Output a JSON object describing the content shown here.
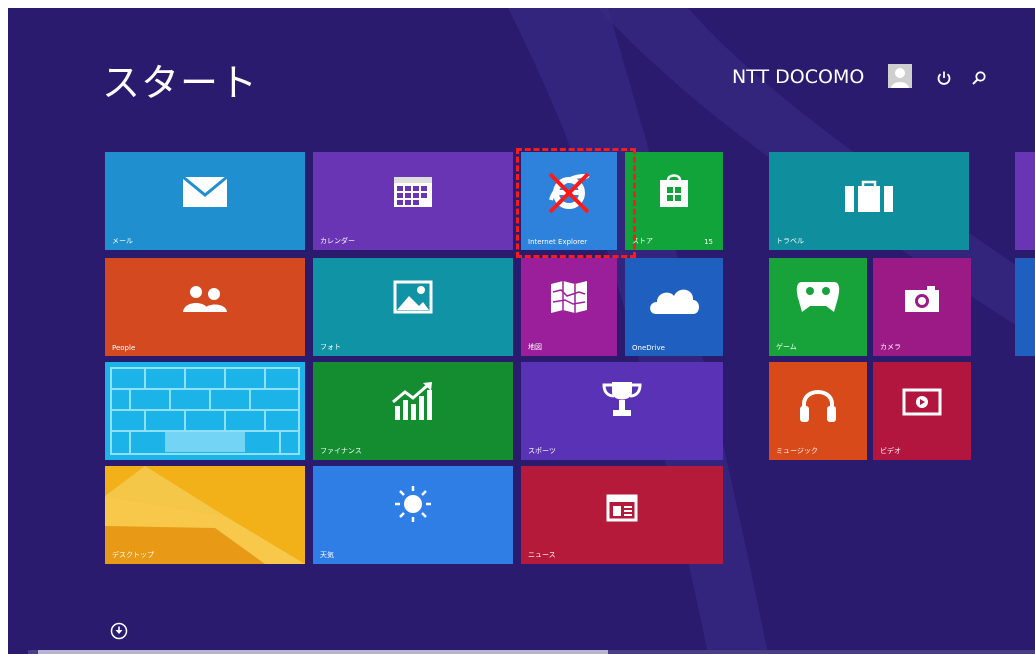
{
  "start_title": "スタート",
  "user_name": "NTT DOCOMO",
  "icons": {
    "user": "user-avatar-icon",
    "power": "power-icon",
    "search": "search-icon",
    "down": "down-arrow-circle-icon"
  },
  "tiles": {
    "mail": {
      "label": "メール",
      "color": "#1f8fcf"
    },
    "calendar": {
      "label": "カレンダー",
      "color": "#6a35b5"
    },
    "ie": {
      "label": "Internet Explorer",
      "color": "#2f82dc"
    },
    "store": {
      "label": "ストア",
      "badge": "15",
      "color": "#10a43a"
    },
    "travel": {
      "label": "トラベル",
      "color": "#0f8f9e"
    },
    "people": {
      "label": "People",
      "color": "#d4491f"
    },
    "photos": {
      "label": "フォト",
      "color": "#0f93a5"
    },
    "maps": {
      "label": "地図",
      "color": "#9b1f9b"
    },
    "onedrive": {
      "label": "OneDrive",
      "color": "#1e5fbf"
    },
    "games": {
      "label": "ゲーム",
      "color": "#17a33a"
    },
    "camera": {
      "label": "カメラ",
      "color": "#9b1a86"
    },
    "desktop_keyboard": {
      "label": "",
      "color": "#1cb3e8"
    },
    "finance": {
      "label": "ファイナンス",
      "color": "#138d2f"
    },
    "sports": {
      "label": "スポーツ",
      "color": "#5a32b5"
    },
    "music": {
      "label": "ミュージック",
      "color": "#d84a1a"
    },
    "video": {
      "label": "ビデオ",
      "color": "#b2163f"
    },
    "desktop": {
      "label": "デスクトップ",
      "color": "#f2b118"
    },
    "weather": {
      "label": "天気",
      "color": "#2f7ee6"
    },
    "news": {
      "label": "ニュース",
      "color": "#b51a3a"
    }
  },
  "annotation": {
    "ie_disabled": true,
    "marker_color": "#ff1a1a"
  }
}
